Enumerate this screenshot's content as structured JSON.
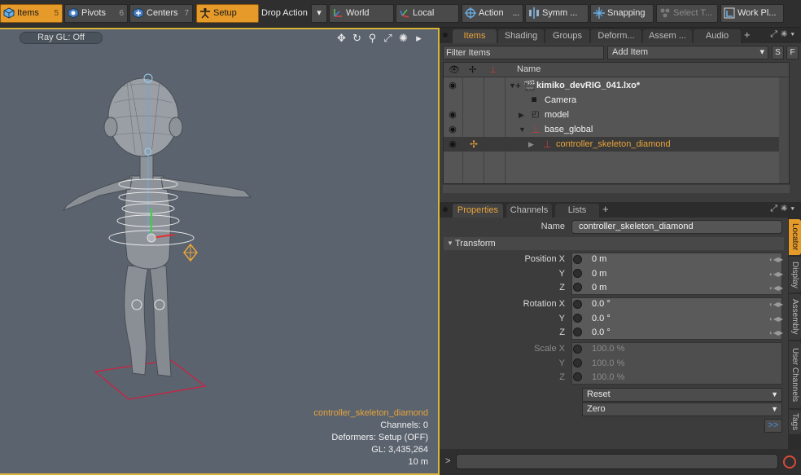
{
  "toolbar": {
    "items_label": "Items",
    "items_key": "5",
    "pivots_label": "Pivots",
    "pivots_key": "6",
    "centers_label": "Centers",
    "centers_key": "7",
    "setup_label": "Setup",
    "drop_action_label": "Drop Action",
    "world_label": "World",
    "local_label": "Local",
    "action_label": "Action",
    "action_more": "...",
    "symmetry_label": "Symm ...",
    "snapping_label": "Snapping",
    "select_through_label": "Select T...",
    "work_plane_label": "Work Pl..."
  },
  "viewport": {
    "ray_gl": "Ray GL: Off",
    "info": {
      "selected": "controller_skeleton_diamond",
      "channels": "Channels: 0",
      "deformers": "Deformers: Setup (OFF)",
      "gl": "GL: 3,435,264",
      "scale": "10 m"
    }
  },
  "top_tabs": {
    "items": "Items",
    "shading": "Shading",
    "groups": "Groups",
    "deform": "Deform...",
    "assem": "Assem ...",
    "audio": "Audio",
    "plus": "+"
  },
  "items_list": {
    "filter_placeholder": "Filter Items",
    "add_item": "Add Item",
    "s_btn": "S",
    "f_btn": "F",
    "name_header": "Name",
    "rows": [
      {
        "label": "kimiko_devRIG_041.lxo*"
      },
      {
        "label": "Camera"
      },
      {
        "label": "model"
      },
      {
        "label": "base_global"
      },
      {
        "label": "controller_skeleton_diamond"
      }
    ]
  },
  "prop_tabs": {
    "properties": "Properties",
    "channels": "Channels",
    "lists": "Lists",
    "plus": "+"
  },
  "properties": {
    "name_label": "Name",
    "name_value": "controller_skeleton_diamond",
    "transform_section": "Transform",
    "position_x_label": "Position X",
    "y_label": "Y",
    "z_label": "Z",
    "position_x": "0 m",
    "position_y": "0 m",
    "position_z": "0 m",
    "rotation_x_label": "Rotation X",
    "rotation_x": "0.0 °",
    "rotation_y": "0.0 °",
    "rotation_z": "0.0 °",
    "scale_x_label": "Scale X",
    "scale_x": "100.0 %",
    "scale_y": "100.0 %",
    "scale_z": "100.0 %",
    "reset": "Reset",
    "zero": "Zero",
    "more": ">>"
  },
  "side_tabs": {
    "locator": "Locator",
    "display": "Display",
    "assembly": "Assembly",
    "user_channels": "User Channels",
    "tags": "Tags"
  },
  "command": {
    "prompt": ">"
  },
  "colors": {
    "accent": "#e59a2a",
    "selection": "#e8a43a",
    "viewport": "#5b636e"
  }
}
